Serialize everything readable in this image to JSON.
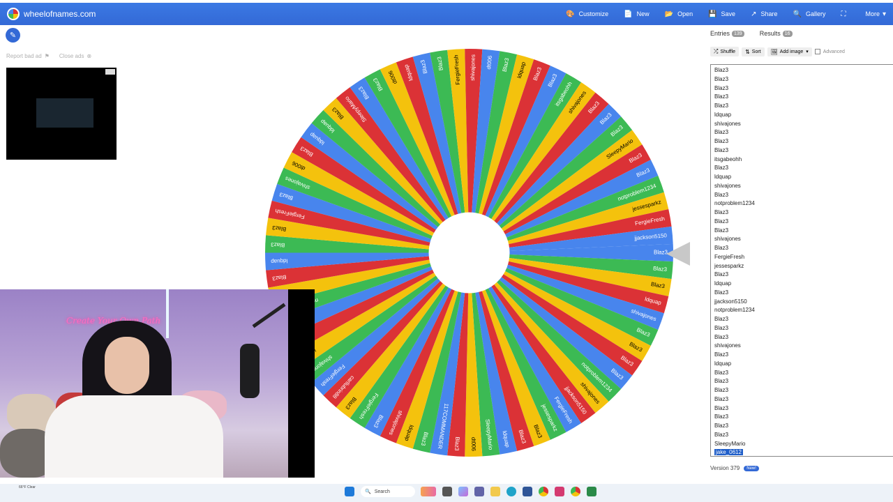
{
  "topbar": {
    "site_name": "wheelofnames.com",
    "nav": [
      {
        "label": "Customize",
        "icon": "palette-icon"
      },
      {
        "label": "New",
        "icon": "file-icon"
      },
      {
        "label": "Open",
        "icon": "folder-icon"
      },
      {
        "label": "Save",
        "icon": "save-icon"
      },
      {
        "label": "Share",
        "icon": "share-icon"
      },
      {
        "label": "Gallery",
        "icon": "search-icon"
      },
      {
        "label": "",
        "icon": "fullscreen-icon"
      },
      {
        "label": "More",
        "icon": "chevron-down-icon"
      }
    ]
  },
  "ads": {
    "report_label": "Report bad ad",
    "close_label": "Close ads"
  },
  "colors": {
    "red": "#db3236",
    "yellow": "#f4c20d",
    "green": "#3cba54",
    "blue": "#4885ed",
    "brand": "#3369d6"
  },
  "wheel_names": [
    "Blaz3",
    "Blaz3",
    "Blaz3",
    "ldquap",
    "shivajones",
    "Blaz3",
    "Blaz3",
    "Blaz3",
    "Blaz3",
    "notproblem1234",
    "shivajones",
    "jjackson5150",
    "FergieFresh",
    "jessesparkz",
    "Blaz3",
    "Blaz3",
    "ldquap",
    "SleepyMario",
    "dt006",
    "Blaz3",
    "117COMMANDER",
    "Blaz3",
    "ldquap",
    "shivajones",
    "Blaz3",
    "FergieFresh",
    "Blaz3",
    "carllubrin88",
    "FergieFresh",
    "shivajones",
    "ldquap",
    "dt006",
    "shivajones",
    "notproblem1234",
    "Blaz3",
    "Blaz3",
    "ldquap",
    "Blaz3",
    "Blaz3",
    "FergieFresh",
    "Blaz3",
    "shivajones",
    "dt006",
    "Blaz3",
    "ldquap",
    "ldquap",
    "Blaz3",
    "SleepyMario",
    "Blaz3",
    "Blaz3",
    "dt006",
    "ldquap",
    "Blaz3",
    "Blaz3",
    "FergieFresh",
    "shivajones",
    "dt006",
    "Blaz3",
    "ldquap",
    "Blaz3",
    "Blaz3",
    "itsgabeohh",
    "shivajones",
    "Blaz3",
    "Blaz3",
    "Blaz3",
    "SleepyMario",
    "Blaz3",
    "Blaz3",
    "notproblem1234",
    "jessesparkz",
    "FergieFresh",
    "jjackson5150"
  ],
  "panel": {
    "tabs": [
      {
        "label": "Entries",
        "count": "139"
      },
      {
        "label": "Results",
        "count": "16"
      }
    ],
    "tools": [
      {
        "label": "Shuffle",
        "icon": "shuffle-icon"
      },
      {
        "label": "Sort",
        "icon": "sort-icon"
      },
      {
        "label": "Add image",
        "icon": "image-icon"
      }
    ],
    "advanced_label": "Advanced",
    "entries": [
      "Blaz3",
      "Blaz3",
      "Blaz3",
      "Blaz3",
      "Blaz3",
      "ldquap",
      "shivajones",
      "Blaz3",
      "Blaz3",
      "Blaz3",
      "itsgabeohh",
      "Blaz3",
      "ldquap",
      "shivajones",
      "Blaz3",
      "notproblem1234",
      "Blaz3",
      "Blaz3",
      "Blaz3",
      "shivajones",
      "Blaz3",
      "FergieFresh",
      "jessesparkz",
      "Blaz3",
      "ldquap",
      "Blaz3",
      "jjackson5150",
      "notproblem1234",
      "Blaz3",
      "Blaz3",
      "Blaz3",
      "shivajones",
      "Blaz3",
      "ldquap",
      "Blaz3",
      "Blaz3",
      "Blaz3",
      "Blaz3",
      "Blaz3",
      "Blaz3",
      "Blaz3",
      "Blaz3",
      "SleepyMario",
      "jake_0612"
    ],
    "version_label": "Version 379",
    "new_badge": "New!"
  },
  "webcam": {
    "neon_text": "Create Your Own Path"
  },
  "taskbar": {
    "weather": "66°F Clear",
    "search_label": "Search"
  }
}
